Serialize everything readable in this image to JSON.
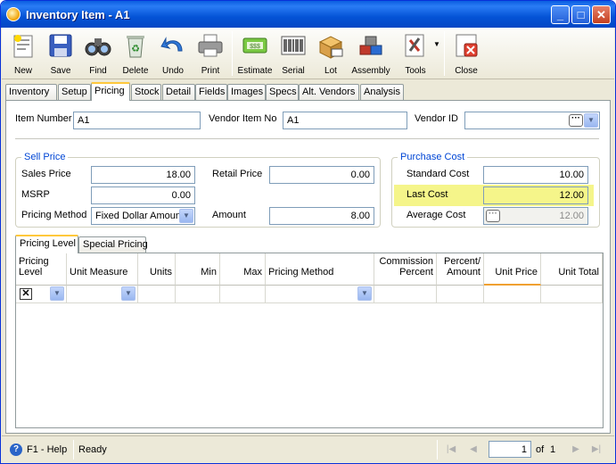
{
  "window": {
    "title": "Inventory Item - A1"
  },
  "toolbar": {
    "items": [
      {
        "label": "New",
        "icon": "new-icon"
      },
      {
        "label": "Save",
        "icon": "save-icon"
      },
      {
        "label": "Find",
        "icon": "binoculars-icon"
      },
      {
        "label": "Delete",
        "icon": "recycle-bin-icon"
      },
      {
        "label": "Undo",
        "icon": "undo-icon"
      },
      {
        "label": "Print",
        "icon": "printer-icon"
      },
      {
        "label": "Estimate",
        "icon": "estimate-icon"
      },
      {
        "label": "Serial",
        "icon": "barcode-icon"
      },
      {
        "label": "Lot",
        "icon": "lot-icon"
      },
      {
        "label": "Assembly",
        "icon": "assembly-icon"
      },
      {
        "label": "Tools",
        "icon": "tools-icon"
      },
      {
        "label": "Close",
        "icon": "close-doc-icon"
      }
    ]
  },
  "tabs": [
    "Inventory",
    "Setup",
    "Pricing",
    "Stock",
    "Detail",
    "Fields",
    "Images",
    "Specs",
    "Alt. Vendors",
    "Analysis"
  ],
  "active_tab": "Pricing",
  "form": {
    "item_number_label": "Item Number",
    "item_number": "A1",
    "vendor_item_no_label": "Vendor Item No",
    "vendor_item_no": "A1",
    "vendor_id_label": "Vendor ID",
    "vendor_id": ""
  },
  "sell_price": {
    "title": "Sell Price",
    "sales_price_label": "Sales Price",
    "sales_price": "18.00",
    "msrp_label": "MSRP",
    "msrp": "0.00",
    "pricing_method_label": "Pricing Method",
    "pricing_method": "Fixed Dollar Amount",
    "retail_price_label": "Retail Price",
    "retail_price": "0.00",
    "amount_label": "Amount",
    "amount": "8.00"
  },
  "purchase_cost": {
    "title": "Purchase Cost",
    "standard_cost_label": "Standard Cost",
    "standard_cost": "10.00",
    "last_cost_label": "Last Cost",
    "last_cost": "12.00",
    "average_cost_label": "Average Cost",
    "average_cost": "12.00"
  },
  "subtabs": [
    "Pricing Level",
    "Special Pricing"
  ],
  "grid": {
    "columns": [
      {
        "line1": "Pricing",
        "line2": "Level"
      },
      {
        "line1": "",
        "line2": "Unit Measure"
      },
      {
        "line1": "",
        "line2": "Units"
      },
      {
        "line1": "",
        "line2": "Min"
      },
      {
        "line1": "",
        "line2": "Max"
      },
      {
        "line1": "",
        "line2": "Pricing Method"
      },
      {
        "line1": "Commission",
        "line2": "Percent"
      },
      {
        "line1": "Percent/",
        "line2": "Amount"
      },
      {
        "line1": "",
        "line2": "Unit Price"
      },
      {
        "line1": "",
        "line2": "Unit Total"
      }
    ]
  },
  "status": {
    "help": "F1 - Help",
    "state": "Ready",
    "page": "1",
    "of_label": "of",
    "total_pages": "1"
  }
}
